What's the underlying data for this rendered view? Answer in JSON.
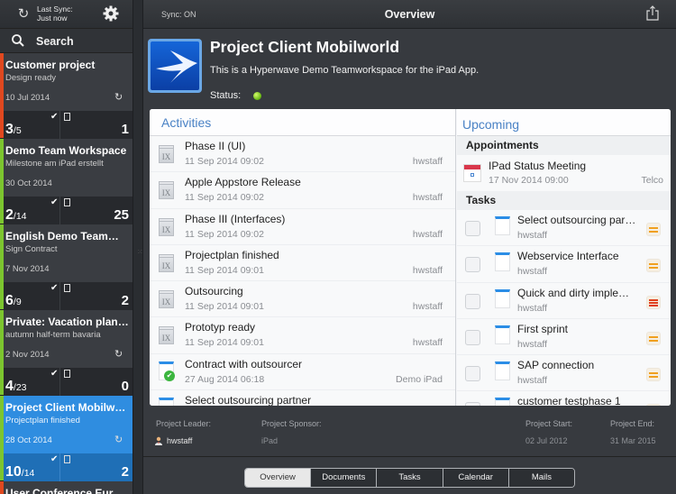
{
  "sidebar": {
    "last_sync_label": "Last Sync:",
    "last_sync_value": "Just now",
    "search_label": "Search",
    "projects": [
      {
        "title": "Customer project",
        "subtitle": "Design ready",
        "date": "10 Jul 2014",
        "done": "3",
        "total": "/5",
        "docs": "1",
        "color": "#e0481f",
        "synced": true
      },
      {
        "title": "Demo Team Workspace",
        "subtitle": "Milestone am iPad erstellt",
        "date": "30 Oct 2014",
        "done": "2",
        "total": "/14",
        "docs": "25",
        "color": "#7cc52f",
        "synced": false
      },
      {
        "title": "English Demo Team…",
        "subtitle": "Sign Contract",
        "date": "7 Nov 2014",
        "done": "6",
        "total": "/9",
        "docs": "2",
        "color": "#7cc52f",
        "synced": false
      },
      {
        "title": "Private: Vacation plan…",
        "subtitle": "autumn half-term bavaria",
        "date": "2 Nov 2014",
        "done": "4",
        "total": "/23",
        "docs": "0",
        "color": "#7cc52f",
        "synced": true
      },
      {
        "title": "Project Client Mobilw…",
        "subtitle": "Projectplan finished",
        "date": "28 Oct 2014",
        "done": "10",
        "total": "/14",
        "docs": "2",
        "color": "#7cc52f",
        "synced": true,
        "selected": true
      },
      {
        "title": "User Conference Eur…",
        "color": "#e0481f"
      }
    ]
  },
  "topbar": {
    "sync_status": "Sync: ON",
    "title": "Overview"
  },
  "project": {
    "title": "Project Client Mobilworld",
    "description": "This is a Hyperwave Demo Teamworkspace for the iPad App.",
    "status_label": "Status:",
    "status_color": "#64b510"
  },
  "activities": {
    "heading": "Activities",
    "items": [
      {
        "title": "Phase II (UI)",
        "date": "11 Sep 2014 09:02",
        "user": "hwstaff",
        "type": "milestone"
      },
      {
        "title": "Apple Appstore Release",
        "date": "11 Sep 2014 09:02",
        "user": "hwstaff",
        "type": "milestone"
      },
      {
        "title": "Phase III (Interfaces)",
        "date": "11 Sep 2014 09:02",
        "user": "hwstaff",
        "type": "milestone"
      },
      {
        "title": "Projectplan finished",
        "date": "11 Sep 2014 09:01",
        "user": "hwstaff",
        "type": "milestone"
      },
      {
        "title": "Outsourcing",
        "date": "11 Sep 2014 09:01",
        "user": "hwstaff",
        "type": "milestone"
      },
      {
        "title": "Prototyp ready",
        "date": "11 Sep 2014 09:01",
        "user": "hwstaff",
        "type": "milestone"
      },
      {
        "title": "Contract with outsourcer",
        "date": "27 Aug 2014 06:18",
        "user": "Demo iPad",
        "type": "task-done"
      },
      {
        "title": "Select outsourcing partner",
        "date": "",
        "user": "",
        "type": "task"
      }
    ]
  },
  "upcoming": {
    "heading": "Upcoming",
    "appointments_label": "Appointments",
    "appointments": [
      {
        "title": "IPad Status Meeting",
        "date": "17 Nov 2014 09:00",
        "location": "Telco"
      }
    ],
    "tasks_label": "Tasks",
    "tasks": [
      {
        "title": "Select outsourcing par…",
        "user": "hwstaff",
        "priority": "medium"
      },
      {
        "title": "Webservice Interface",
        "user": "hwstaff",
        "priority": "medium"
      },
      {
        "title": "Quick and dirty imple…",
        "user": "hwstaff",
        "priority": "high"
      },
      {
        "title": "First sprint",
        "user": "hwstaff",
        "priority": "medium"
      },
      {
        "title": "SAP connection",
        "user": "hwstaff",
        "priority": "medium"
      },
      {
        "title": "customer testphase 1",
        "user": "",
        "priority": "medium"
      }
    ],
    "priority_colors": {
      "medium": "#f0a020",
      "high": "#e0401c"
    }
  },
  "info": {
    "leader_label": "Project Leader:",
    "leader_value": "hwstaff",
    "sponsor_label": "Project Sponsor:",
    "sponsor_value": "iPad",
    "start_label": "Project Start:",
    "start_value": "02 Jul 2012",
    "end_label": "Project End:",
    "end_value": "31 Mar 2015"
  },
  "tabs": [
    {
      "label": "Overview",
      "active": true
    },
    {
      "label": "Documents"
    },
    {
      "label": "Tasks"
    },
    {
      "label": "Calendar"
    },
    {
      "label": "Mails"
    }
  ]
}
